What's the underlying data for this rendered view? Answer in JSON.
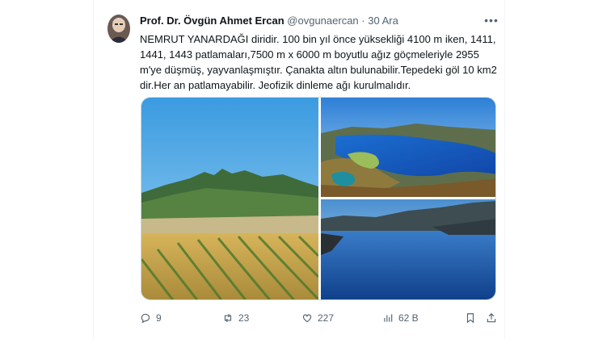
{
  "tweet": {
    "author_name": "Prof. Dr. Övgün Ahmet Ercan",
    "handle": "@ovgunaercan",
    "separator": "·",
    "date": "30 Ara",
    "more_label": "•••",
    "text": "NEMRUT YANARDAĞI diridir. 100 bin yıl önce yüksekliği 4100 m iken, 1411, 1441, 1443 patlamaları,7500 m x 6000 m boyutlu ağız göçmeleriyle 2955 m'ye düşmüş, yayvanlaşmıştır. Çanakta altın bulunabilir.Tepedeki göl 10 km2 dir.Her an patlamayabilir. Jeofizik dinleme ağı kurulmalıdır."
  },
  "media": {
    "images": [
      "mountain-field-photo",
      "crater-lake-aerial-photo",
      "crater-lake-shore-photo"
    ]
  },
  "actions": {
    "replies": "9",
    "retweets": "23",
    "likes": "227",
    "views": "62 B"
  },
  "colors": {
    "text": "#0f1419",
    "secondary": "#536471",
    "border": "#cfd9de"
  }
}
